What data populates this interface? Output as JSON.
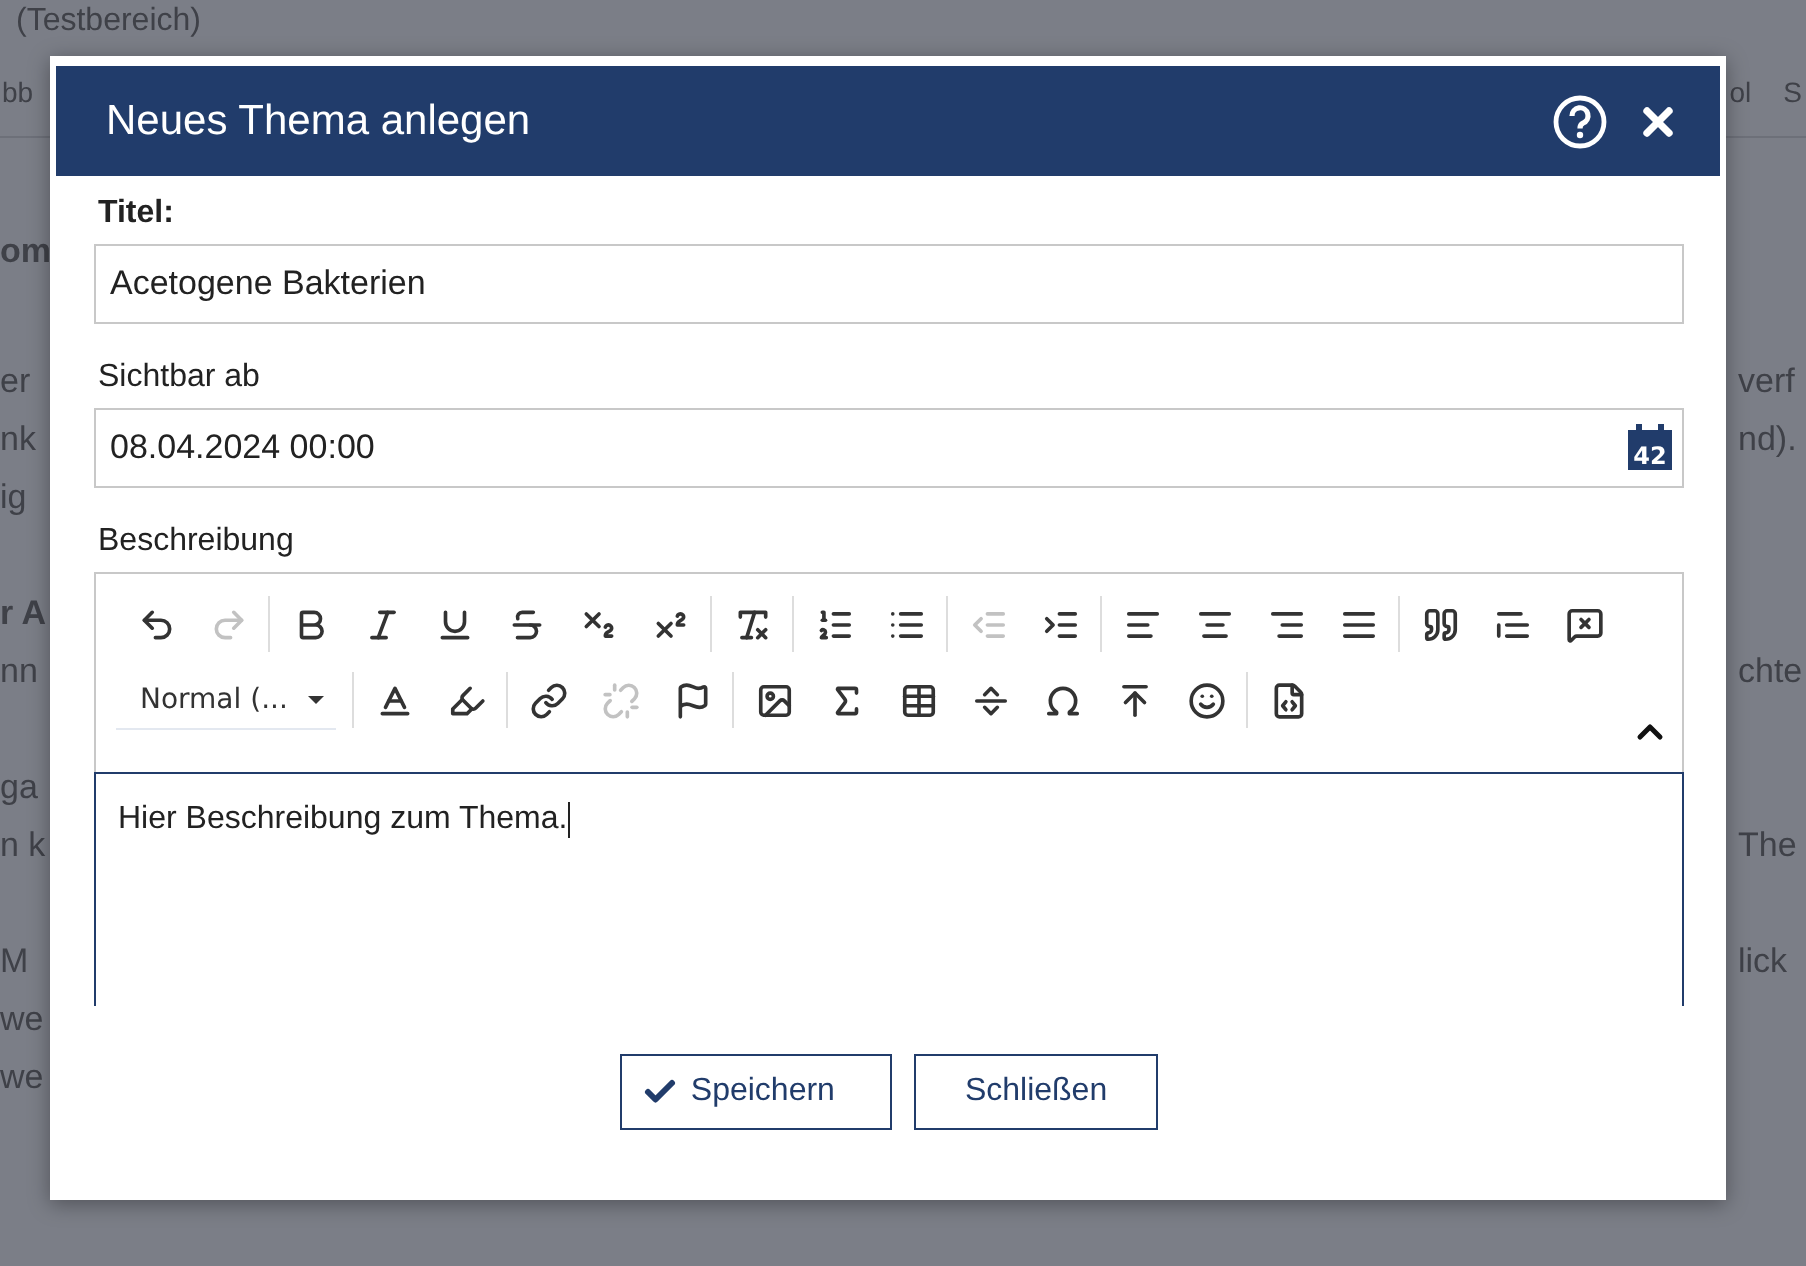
{
  "background_page": {
    "heading": "(Testbereich)",
    "nav_left": "bb",
    "nav_right": [
      "ol",
      "S"
    ],
    "paragraphs": [
      {
        "lines": [
          {
            "left": "om",
            "bold": true
          }
        ]
      },
      {
        "lines": [
          {
            "left": "er",
            "right": "verf",
            "bold": false
          },
          {
            "left": "nk",
            "right": "nd).",
            "bold": false
          },
          {
            "left": "ig",
            "bold": false
          }
        ]
      },
      {
        "lines": [
          {
            "left": "r A",
            "bold": true
          },
          {
            "left": "nn",
            "right": "chte",
            "bold": false
          }
        ]
      },
      {
        "lines": [
          {
            "left": "ga",
            "bold": false
          },
          {
            "left": "n k",
            "right": "The",
            "bold": false
          }
        ]
      },
      {
        "lines": [
          {
            "left": "M",
            "right": "lick",
            "bold": false
          },
          {
            "left": "we",
            "bold": false
          },
          {
            "left": "we",
            "bold": false
          }
        ]
      }
    ]
  },
  "dialog": {
    "title": "Neues Thema anlegen",
    "title_field": {
      "label": "Titel:",
      "value": "Acetogene Bakterien"
    },
    "date_field": {
      "label": "Sichtbar ab",
      "value": "08.04.2024 00:00",
      "calendar_day": "42"
    },
    "description": {
      "label": "Beschreibung",
      "format_select": "Normal (...",
      "text": "Hier Beschreibung zum Thema.",
      "toolbar_collapsed": false,
      "toolbar_row_1": [
        [
          {
            "disabled": false
          },
          {
            "disabled": true
          }
        ],
        [
          {
            "disabled": false
          },
          {
            "disabled": false
          },
          {
            "disabled": false
          },
          {
            "disabled": false
          },
          {
            "disabled": false
          },
          {
            "disabled": false
          }
        ],
        [
          {
            "disabled": false
          }
        ],
        [
          {
            "disabled": false
          },
          {
            "disabled": false
          }
        ],
        [
          {
            "disabled": true
          },
          {
            "disabled": false
          }
        ],
        [
          {
            "disabled": false
          },
          {
            "disabled": false
          },
          {
            "disabled": false
          },
          {
            "disabled": false
          }
        ],
        [
          {
            "disabled": false
          },
          {
            "disabled": false
          },
          {
            "disabled": false
          }
        ]
      ],
      "toolbar_row_2": [
        [
          {
            "disabled": false
          },
          {
            "disabled": false
          }
        ],
        [
          {
            "disabled": false
          },
          {
            "disabled": true
          },
          {
            "disabled": false
          }
        ],
        [
          {
            "disabled": false
          },
          {
            "disabled": false
          },
          {
            "disabled": false
          },
          {
            "disabled": false
          },
          {
            "disabled": false
          },
          {
            "disabled": false
          },
          {
            "disabled": false
          }
        ],
        [
          {
            "disabled": false
          }
        ]
      ]
    },
    "buttons": [
      {
        "label": "Speichern",
        "kind": "save"
      },
      {
        "label": "Schließen",
        "kind": "close"
      }
    ]
  }
}
